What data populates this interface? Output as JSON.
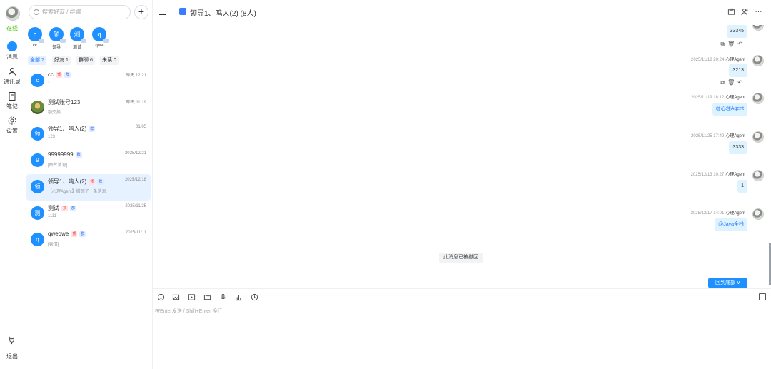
{
  "rail": {
    "status": "在线",
    "items": [
      {
        "label": "消息",
        "icon": "message-icon"
      },
      {
        "label": "通讯录",
        "icon": "contacts-icon"
      },
      {
        "label": "笔记",
        "icon": "notes-icon"
      },
      {
        "label": "设置",
        "icon": "settings-icon"
      }
    ],
    "logout": "退出"
  },
  "search": {
    "placeholder": "搜索好友 / 群聊"
  },
  "quick_contacts": [
    {
      "avatar": "c",
      "name": "cc"
    },
    {
      "avatar": "领",
      "name": "领导"
    },
    {
      "avatar": "测",
      "name": "测试"
    },
    {
      "avatar": "q",
      "name": "qwe"
    }
  ],
  "filters": [
    "全部 7",
    "好友 1",
    "群聊 6",
    "未读 0"
  ],
  "conversations": [
    {
      "avatar": "c",
      "name": "cc",
      "tags": [
        "顶",
        "群"
      ],
      "preview": "1",
      "time": "昨天 12:21"
    },
    {
      "avatar": "",
      "name": "测试账号123",
      "tags": [],
      "preview": "额交换",
      "time": "昨天 11:19"
    },
    {
      "avatar": "领",
      "name": "领导1、鸣人(2)",
      "tags": [
        "群"
      ],
      "preview": "123",
      "time": "01/05"
    },
    {
      "avatar": "9",
      "name": "99999999",
      "tags": [
        "群"
      ],
      "preview": "[图片消息]",
      "time": "2025/12/21"
    },
    {
      "avatar": "领",
      "name": "领导1、鸣人(2)",
      "tags": [
        "顶",
        "群"
      ],
      "preview": "【心理Agent】撤回了一条消息",
      "time": "2025/12/18"
    },
    {
      "avatar": "测",
      "name": "测试",
      "tags": [
        "顶",
        "群"
      ],
      "preview": "1111",
      "time": "2025/11/25"
    },
    {
      "avatar": "q",
      "name": "qweqwe",
      "tags": [
        "顶",
        "群"
      ],
      "preview": "[表情]",
      "time": "2025/11/11"
    }
  ],
  "header": {
    "title": "领导1、鸣人(2) (8人)"
  },
  "messages": [
    {
      "meta": "",
      "sender": "",
      "text": "33345",
      "link": false
    },
    {
      "meta": "2025/11/18 20:24",
      "sender": "心理Agent",
      "text": "3213",
      "link": false
    },
    {
      "meta": "2025/11/19 18:12",
      "sender": "心理Agent",
      "text": "@心理Agent",
      "link": true
    },
    {
      "meta": "2025/11/25 17:49",
      "sender": "心理Agent",
      "text": "3333",
      "link": false
    },
    {
      "meta": "2025/12/13 10:27",
      "sender": "心理Agent",
      "text": "1",
      "link": false
    },
    {
      "meta": "2025/12/17 14:01",
      "sender": "心理Agent",
      "text": "@Java全栈",
      "link": true
    }
  ],
  "recalled_notice": "此消息已被撤回",
  "back_to_bottom": "回到底部 ∨",
  "composer": {
    "placeholder": "按Enter发送 / Shift+Enter 换行",
    "tools": [
      "emoji-icon",
      "image-icon",
      "video-icon",
      "folder-icon",
      "microphone-icon",
      "chart-icon",
      "history-icon"
    ]
  }
}
